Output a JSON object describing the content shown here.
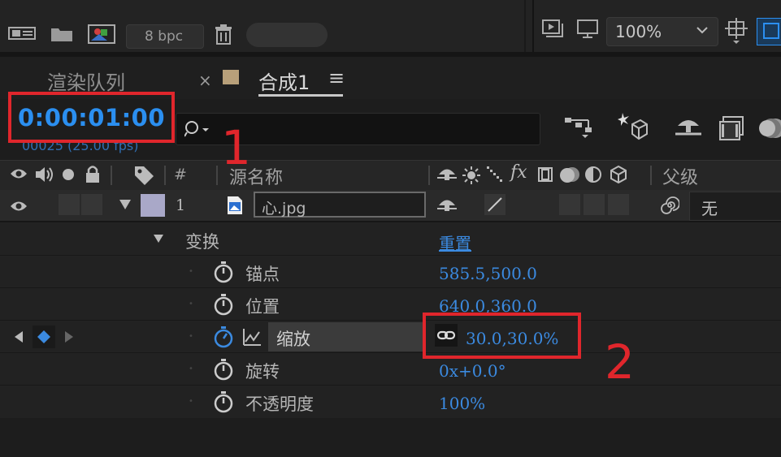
{
  "top": {
    "bpc": "8 bpc",
    "zoom": "100%"
  },
  "tabs": {
    "render_queue": "渲染队列",
    "close": "×",
    "comp_name": "合成1",
    "menu": "≡"
  },
  "timecode": {
    "value": "0:00:01:00",
    "frames": "00025 (25.00 fps)"
  },
  "header": {
    "hash": "#",
    "source_name": "源名称",
    "parent": "父级",
    "fx": "fx"
  },
  "layer": {
    "number": "1",
    "name": "心.jpg",
    "parent_value": "无"
  },
  "transform": {
    "label": "变换",
    "reset": "重置",
    "properties": [
      {
        "name": "锚点",
        "value": "585.5,500.0"
      },
      {
        "name": "位置",
        "value": "640.0,360.0"
      },
      {
        "name": "缩放",
        "value": "30.0,30.0%"
      },
      {
        "name": "旋转",
        "value": "0x+0.0°"
      },
      {
        "name": "不透明度",
        "value": "100%"
      }
    ]
  },
  "annotations": {
    "label1": "1",
    "label2": "2"
  },
  "colors": {
    "accent_blue": "#2b8ff0",
    "annotation_red": "#e0262c",
    "layer_label": "#a9a8c8"
  }
}
